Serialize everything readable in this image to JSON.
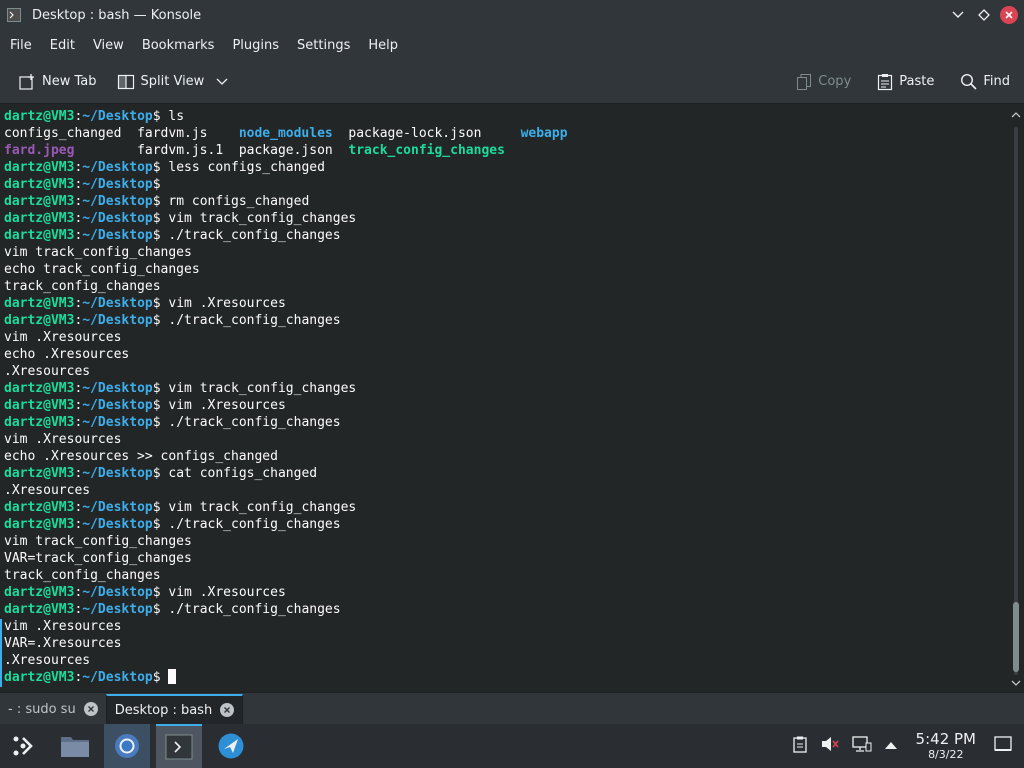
{
  "window": {
    "title": "Desktop : bash — Konsole",
    "icon": "terminal-icon",
    "controls": [
      "minimize-icon",
      "maximize-icon",
      "close-icon"
    ]
  },
  "menu": [
    "File",
    "Edit",
    "View",
    "Bookmarks",
    "Plugins",
    "Settings",
    "Help"
  ],
  "toolbar": {
    "new_tab": "New Tab",
    "split_view": "Split View",
    "copy": "Copy",
    "paste": "Paste",
    "find": "Find"
  },
  "terminal": {
    "prompt_user": "dartz@VM3",
    "prompt_path": "~/Desktop",
    "lines": [
      {
        "type": "prompt",
        "cmd": "ls"
      },
      {
        "type": "ls",
        "segments": [
          {
            "text": "configs_changed  ",
            "kind": "plain"
          },
          {
            "text": "fardvm.js    ",
            "kind": "plain"
          },
          {
            "text": "node_modules",
            "kind": "dir"
          },
          {
            "text": "  package-lock.json     ",
            "kind": "plain"
          },
          {
            "text": "webapp",
            "kind": "dir"
          }
        ]
      },
      {
        "type": "ls",
        "segments": [
          {
            "text": "fard.jpeg",
            "kind": "img"
          },
          {
            "text": "        fardvm.js.1  package.json  ",
            "kind": "plain"
          },
          {
            "text": "track_config_changes",
            "kind": "exec"
          }
        ]
      },
      {
        "type": "prompt",
        "cmd": "less configs_changed"
      },
      {
        "type": "prompt",
        "cmd": ""
      },
      {
        "type": "prompt",
        "cmd": "rm configs_changed"
      },
      {
        "type": "prompt",
        "cmd": "vim track_config_changes"
      },
      {
        "type": "prompt",
        "cmd": "./track_config_changes"
      },
      {
        "type": "out",
        "text": "vim track_config_changes"
      },
      {
        "type": "out",
        "text": "echo track_config_changes"
      },
      {
        "type": "out",
        "text": "track_config_changes"
      },
      {
        "type": "prompt",
        "cmd": "vim .Xresources"
      },
      {
        "type": "prompt",
        "cmd": "./track_config_changes"
      },
      {
        "type": "out",
        "text": "vim .Xresources"
      },
      {
        "type": "out",
        "text": "echo .Xresources"
      },
      {
        "type": "out",
        "text": ".Xresources"
      },
      {
        "type": "prompt",
        "cmd": "vim track_config_changes"
      },
      {
        "type": "prompt",
        "cmd": "vim .Xresources"
      },
      {
        "type": "prompt",
        "cmd": "./track_config_changes"
      },
      {
        "type": "out",
        "text": "vim .Xresources"
      },
      {
        "type": "out",
        "text": "echo .Xresources >> configs_changed"
      },
      {
        "type": "prompt",
        "cmd": "cat configs_changed"
      },
      {
        "type": "out",
        "text": ".Xresources"
      },
      {
        "type": "prompt",
        "cmd": "vim track_config_changes"
      },
      {
        "type": "prompt",
        "cmd": "./track_config_changes"
      },
      {
        "type": "out",
        "text": "vim track_config_changes"
      },
      {
        "type": "out",
        "text": "VAR=track_config_changes"
      },
      {
        "type": "out",
        "text": "track_config_changes"
      },
      {
        "type": "prompt",
        "cmd": "vim .Xresources"
      },
      {
        "type": "prompt",
        "cmd": "./track_config_changes"
      },
      {
        "type": "out",
        "text": "vim .Xresources"
      },
      {
        "type": "out",
        "text": "VAR=.Xresources"
      },
      {
        "type": "out",
        "text": ".Xresources"
      },
      {
        "type": "prompt",
        "cmd": "",
        "cursor": true
      }
    ]
  },
  "tabs": [
    {
      "label": "- : sudo su",
      "active": false
    },
    {
      "label": "Desktop : bash",
      "active": true
    }
  ],
  "taskbar": {
    "apps": [
      "app-launcher-icon",
      "file-manager-icon",
      "chromium-icon",
      "konsole-icon",
      "network-tool-icon"
    ],
    "tray": [
      "clipboard-icon",
      "volume-muted-icon",
      "network-icon",
      "expand-tray-icon",
      "show-desktop-icon"
    ],
    "time": "5:42 PM",
    "date": "8/3/22"
  },
  "colors": {
    "user": "#1cdc9a",
    "path": "#3daee9",
    "directory": "#3daee9",
    "image": "#9b59b6",
    "executable": "#1cdc9a",
    "close_button": "#da4453",
    "accent": "#3daee9"
  }
}
